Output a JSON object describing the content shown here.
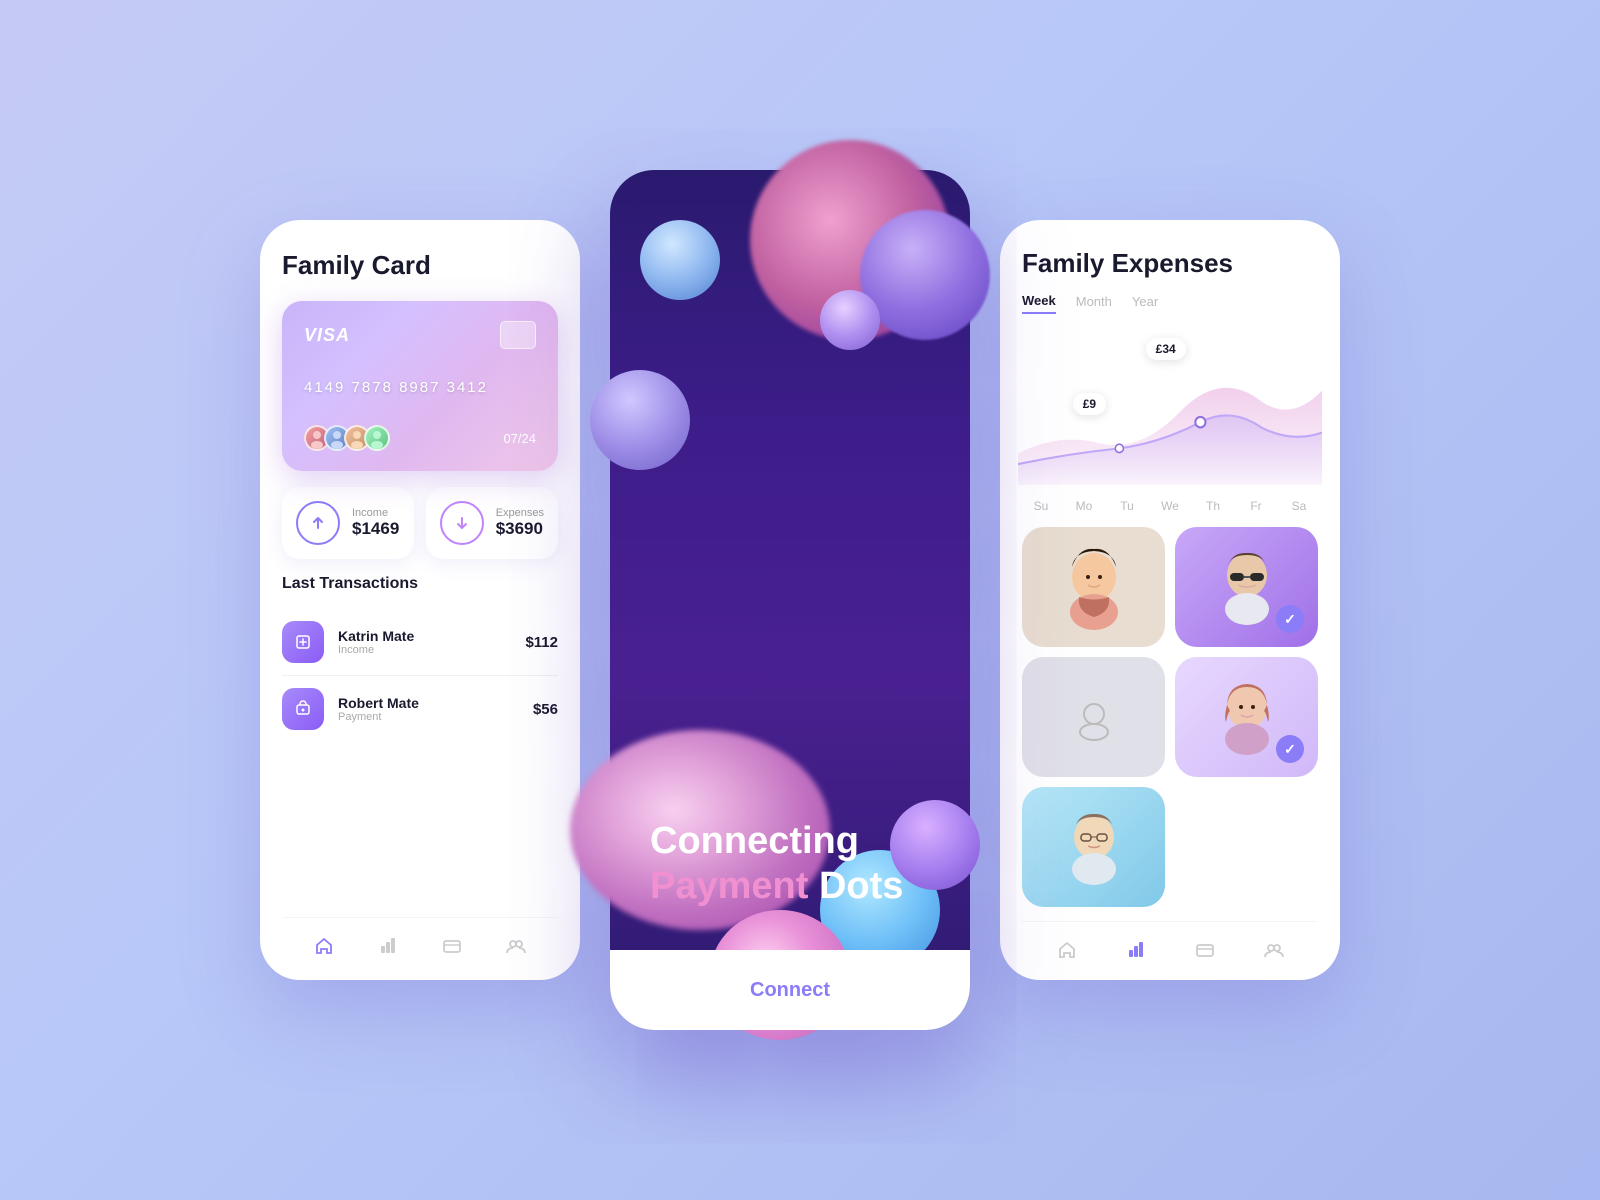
{
  "background": "#b8c8f8",
  "screen1": {
    "title": "Family Card",
    "card": {
      "brand": "VISA",
      "number": "4149 7878 8987 3412",
      "expiry": "07/24"
    },
    "income": {
      "label": "Income",
      "amount": "$1469"
    },
    "expenses": {
      "label": "Expenses",
      "amount": "$3690"
    },
    "transactions_title": "Last Transactions",
    "transactions": [
      {
        "name": "Katrin Mate",
        "type": "Income",
        "amount": "$112"
      },
      {
        "name": "Robert Mate",
        "type": "Payment",
        "amount": "$56"
      }
    ]
  },
  "screen2": {
    "line1": "Connecting",
    "line2_pink": "Payment",
    "line2_white": "Dots",
    "connect_btn": "Connect"
  },
  "screen3": {
    "title": "Family Expenses",
    "tabs": [
      "Week",
      "Month",
      "Year"
    ],
    "active_tab": "Week",
    "chart_labels": [
      "£34",
      "£9"
    ],
    "days": [
      "Su",
      "Mo",
      "Tu",
      "We",
      "Th",
      "Fr",
      "Sa"
    ]
  },
  "icons": {
    "home": "⌂",
    "chart": "⬛",
    "card": "▤",
    "users": "⊞",
    "arrow_up": "↑",
    "arrow_down": "↓",
    "book": "📖",
    "gift": "🎁",
    "check": "✓"
  }
}
